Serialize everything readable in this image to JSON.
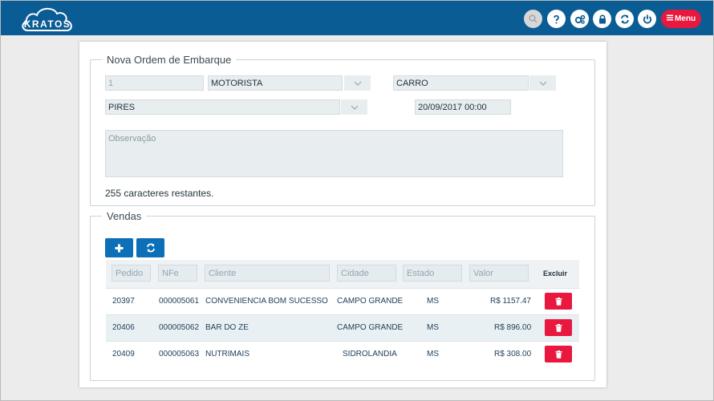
{
  "app": {
    "logo_text": "KRATOS",
    "menu_label": "Menu"
  },
  "toolbar_icons": [
    "search-icon",
    "help-icon",
    "settings-icon",
    "lock-icon",
    "refresh-icon",
    "power-icon"
  ],
  "form": {
    "legend": "Nova Ordem de Embarque",
    "number": "1",
    "driver": "MOTORISTA",
    "vehicle": "CARRO",
    "route": "PIRES",
    "datetime": "20/09/2017 00:00",
    "observation_placeholder": "Observação",
    "remaining_text": "255 caracteres restantes."
  },
  "sales": {
    "legend": "Vendas",
    "filters": {
      "pedido": "Pedido",
      "nfe": "NFe",
      "cliente": "Cliente",
      "cidade": "Cidade",
      "estado": "Estado",
      "valor": "Valor"
    },
    "delete_header": "Excluir",
    "rows": [
      {
        "pedido": "20397",
        "nfe": "000005061",
        "cliente": "CONVENIENCIA BOM SUCESSO",
        "cidade": "CAMPO GRANDE",
        "estado": "MS",
        "valor": "R$ 1157.47"
      },
      {
        "pedido": "20406",
        "nfe": "000005062",
        "cliente": "BAR DO ZE",
        "cidade": "CAMPO GRANDE",
        "estado": "MS",
        "valor": "R$ 896.00"
      },
      {
        "pedido": "20409",
        "nfe": "000005063",
        "cliente": "NUTRIMAIS",
        "cidade": "SIDROLANDIA",
        "estado": "MS",
        "valor": "R$ 308.00"
      }
    ]
  },
  "colors": {
    "header": "#0a5c94",
    "accent_red": "#e8183f",
    "button_blue": "#0d6fb8"
  }
}
